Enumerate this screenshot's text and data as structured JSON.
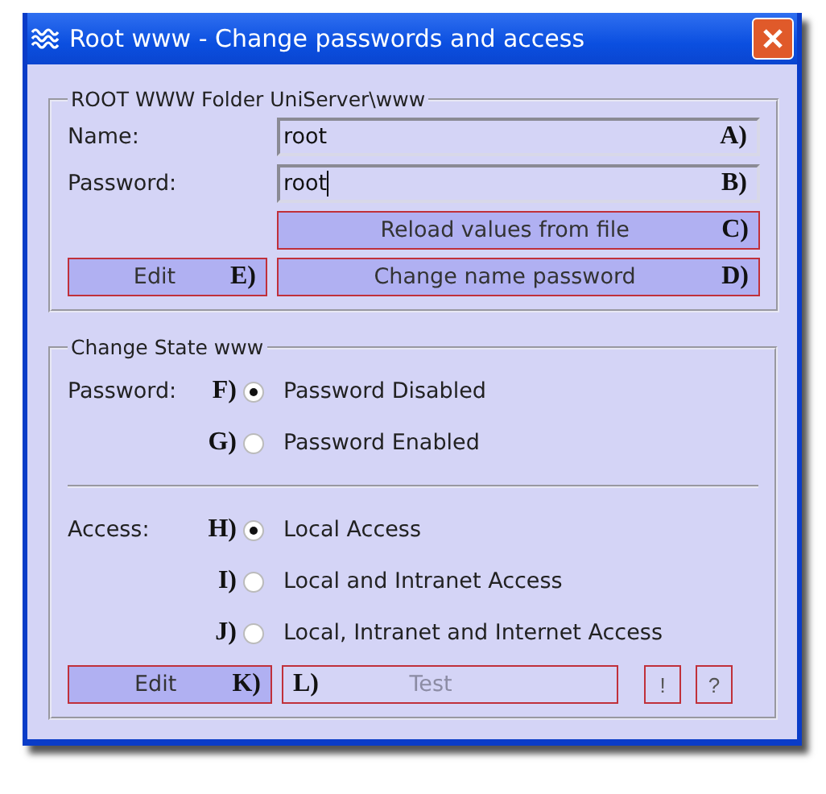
{
  "window": {
    "title": "Root www - Change passwords and access"
  },
  "folder_group": {
    "legend": "ROOT WWW Folder UniServer\\www",
    "fields": [
      {
        "label": "Name:",
        "value": "root",
        "marker": "A)",
        "focused": false
      },
      {
        "label": "Password:",
        "value": "root",
        "marker": "B)",
        "focused": true
      }
    ],
    "reload_button": {
      "label": "Reload values from file",
      "marker": "C)"
    },
    "edit_button": {
      "label": "Edit",
      "marker": "E)"
    },
    "change_button": {
      "label": "Change name password",
      "marker": "D)"
    }
  },
  "state_group": {
    "legend": "Change State www",
    "password": {
      "label": "Password:",
      "options": [
        {
          "marker": "F)",
          "label": "Password Disabled",
          "selected": true
        },
        {
          "marker": "G)",
          "label": "Password Enabled",
          "selected": false
        }
      ]
    },
    "access": {
      "label": "Access:",
      "options": [
        {
          "marker": "H)",
          "label": "Local Access",
          "selected": true
        },
        {
          "marker": "I)",
          "label": "Local and Intranet Access",
          "selected": false
        },
        {
          "marker": "J)",
          "label": "Local, Intranet and Internet Access",
          "selected": false
        }
      ]
    },
    "edit_button": {
      "label": "Edit",
      "marker": "K)",
      "disabled": false
    },
    "test_button": {
      "label": "Test",
      "marker": "L)",
      "disabled": true
    },
    "small_buttons": [
      "!",
      "?"
    ]
  }
}
